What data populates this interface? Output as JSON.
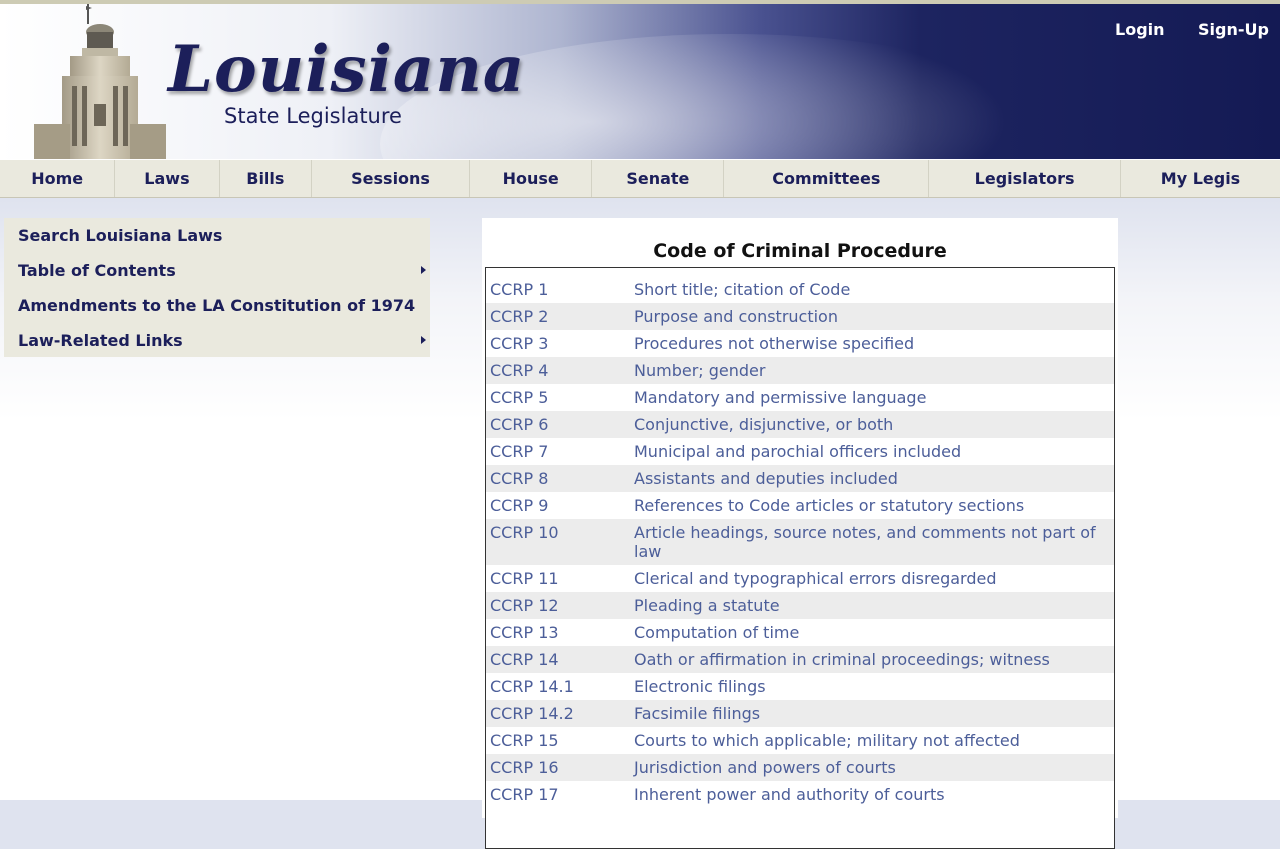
{
  "header": {
    "logo_title": "Louisiana",
    "logo_subtitle": "State Legislature",
    "login": "Login",
    "signup": "Sign-Up"
  },
  "nav": [
    "Home",
    "Laws",
    "Bills",
    "Sessions",
    "House",
    "Senate",
    "Committees",
    "Legislators",
    "My Legis"
  ],
  "sidebar": {
    "items": [
      {
        "label": "Search Louisiana Laws",
        "submenu": false
      },
      {
        "label": "Table of Contents",
        "submenu": true
      },
      {
        "label": "Amendments to the LA Constitution of 1974",
        "submenu": false
      },
      {
        "label": "Law-Related Links",
        "submenu": true
      }
    ]
  },
  "content": {
    "title": "Code of Criminal Procedure",
    "rows": [
      {
        "num": "CCRP 1",
        "title": "Short title; citation of Code"
      },
      {
        "num": "CCRP 2",
        "title": "Purpose and construction"
      },
      {
        "num": "CCRP 3",
        "title": "Procedures not otherwise specified"
      },
      {
        "num": "CCRP 4",
        "title": "Number; gender"
      },
      {
        "num": "CCRP 5",
        "title": "Mandatory and permissive language"
      },
      {
        "num": "CCRP 6",
        "title": "Conjunctive, disjunctive, or both"
      },
      {
        "num": "CCRP 7",
        "title": "Municipal and parochial officers included"
      },
      {
        "num": "CCRP 8",
        "title": "Assistants and deputies included"
      },
      {
        "num": "CCRP 9",
        "title": "References to Code articles or statutory sections"
      },
      {
        "num": "CCRP 10",
        "title": "Article headings, source notes, and comments not part of law"
      },
      {
        "num": "CCRP 11",
        "title": "Clerical and typographical errors disregarded"
      },
      {
        "num": "CCRP 12",
        "title": "Pleading a statute"
      },
      {
        "num": "CCRP 13",
        "title": "Computation of time"
      },
      {
        "num": "CCRP 14",
        "title": "Oath or affirmation in criminal proceedings; witness"
      },
      {
        "num": "CCRP 14.1",
        "title": "Electronic filings"
      },
      {
        "num": "CCRP 14.2",
        "title": "Facsimile filings"
      },
      {
        "num": "CCRP 15",
        "title": "Courts to which applicable; military not affected"
      },
      {
        "num": "CCRP 16",
        "title": "Jurisdiction and powers of courts"
      },
      {
        "num": "CCRP 17",
        "title": "Inherent power and authority of courts"
      }
    ]
  },
  "colors": {
    "navy": "#1c1f5a",
    "link": "#4c5e99",
    "menu_bg": "#eae9de",
    "row_alt": "#ececec"
  }
}
